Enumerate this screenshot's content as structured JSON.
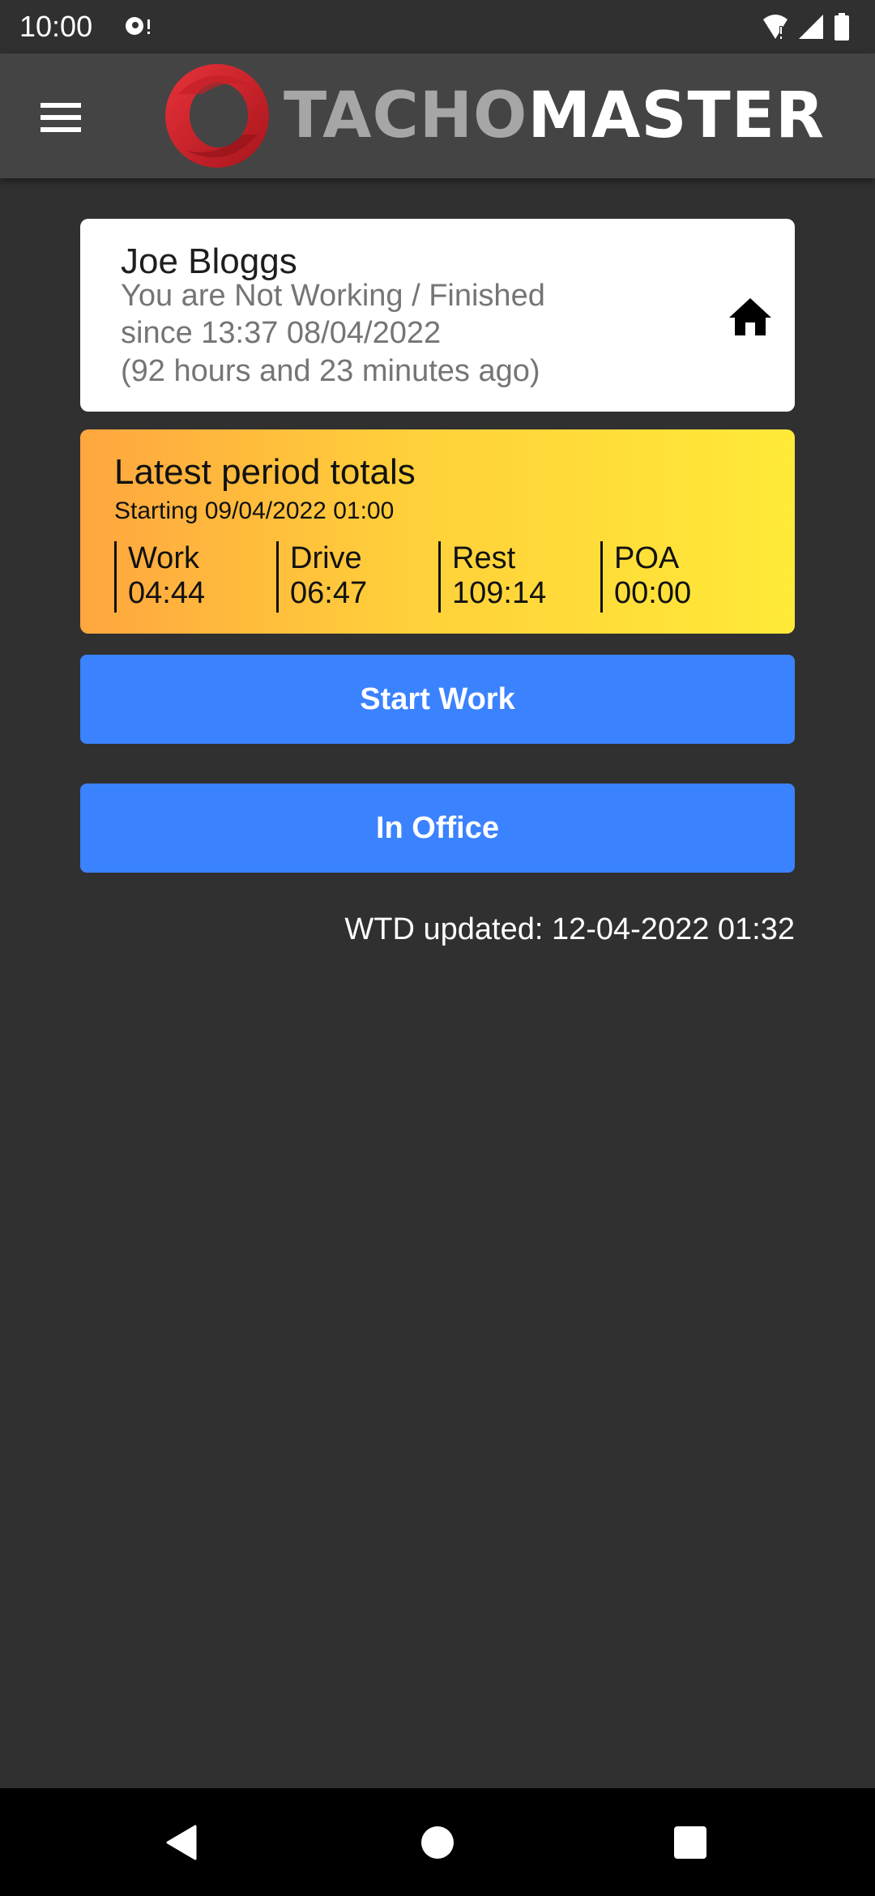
{
  "status_bar": {
    "time": "10:00",
    "icons": [
      "sync-alert-icon",
      "wifi-alert-icon",
      "signal-icon",
      "battery-icon"
    ]
  },
  "app_bar": {
    "menu_icon": "hamburger-menu-icon",
    "logo": {
      "part1": "TACHO",
      "part2": "MASTER"
    },
    "colors": {
      "background": "#444444",
      "logo_ring": "#d42b32",
      "part1": "#a6a6a6",
      "part2": "#ffffff"
    }
  },
  "status_card": {
    "name": "Joe Bloggs",
    "status_line": "You are Not Working / Finished",
    "since_line": "since 13:37 08/04/2022",
    "ago_line": "(92 hours and 23 minutes ago)",
    "icon": "home-icon"
  },
  "totals_card": {
    "title": "Latest period totals",
    "subtitle": "Starting 09/04/2022 01:00",
    "columns": [
      {
        "label": "Work",
        "value": "04:44"
      },
      {
        "label": "Drive",
        "value": "06:47"
      },
      {
        "label": "Rest",
        "value": "109:14"
      },
      {
        "label": "POA",
        "value": "00:00"
      }
    ],
    "gradient": [
      "#ffa63f",
      "#ffea38"
    ]
  },
  "buttons": {
    "start_work": "Start Work",
    "in_office": "In Office",
    "color": "#3b82ff"
  },
  "wtd_updated": "WTD updated: 12-04-2022 01:32",
  "nav_bar": {
    "back": "back-icon",
    "home": "home-circle-icon",
    "recents": "recents-icon"
  }
}
